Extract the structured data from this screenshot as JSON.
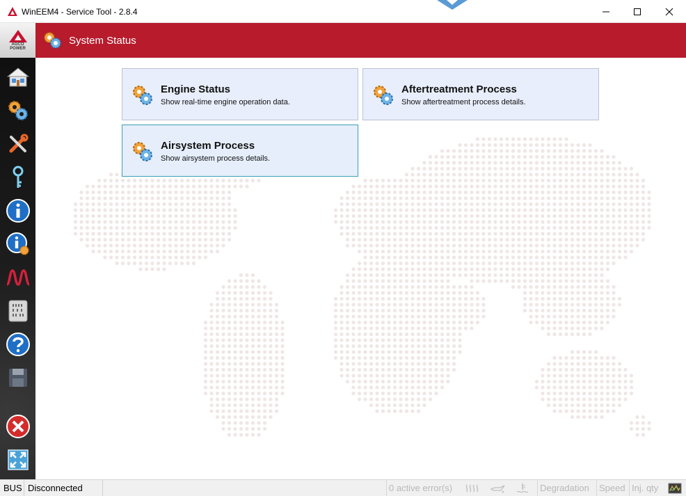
{
  "window": {
    "title": "WinEEM4 - Service Tool - 2.8.4"
  },
  "header": {
    "title": "System Status",
    "logo_lines": [
      "AGCO",
      "POWER"
    ]
  },
  "sidebar": {
    "items": [
      {
        "icon": "home-icon"
      },
      {
        "icon": "gears-icon"
      },
      {
        "icon": "tools-icon"
      },
      {
        "icon": "key-icon"
      },
      {
        "icon": "info-icon"
      },
      {
        "icon": "info-settings-icon"
      },
      {
        "icon": "waveform-icon"
      },
      {
        "icon": "binary-data-icon"
      },
      {
        "icon": "help-icon"
      },
      {
        "icon": "save-icon"
      },
      {
        "icon": "exit-icon"
      },
      {
        "icon": "fullscreen-icon"
      }
    ]
  },
  "tiles": [
    {
      "title": "Engine Status",
      "description": "Show real-time engine operation data."
    },
    {
      "title": "Aftertreatment Process",
      "description": "Show aftertreatment process details."
    },
    {
      "title": "Airsystem Process",
      "description": "Show airsystem process details."
    }
  ],
  "statusbar": {
    "bus_label": "BUS",
    "connection_status": "Disconnected",
    "active_errors": "0 active error(s)",
    "degradation": "Degradation",
    "speed": "Speed",
    "inj_qty": "Inj. qty"
  },
  "colors": {
    "accent_red": "#b71b2c",
    "tile_background": "#e8eefb",
    "selected_border": "#3a9fb5",
    "map_dots": "#efe6e6"
  }
}
